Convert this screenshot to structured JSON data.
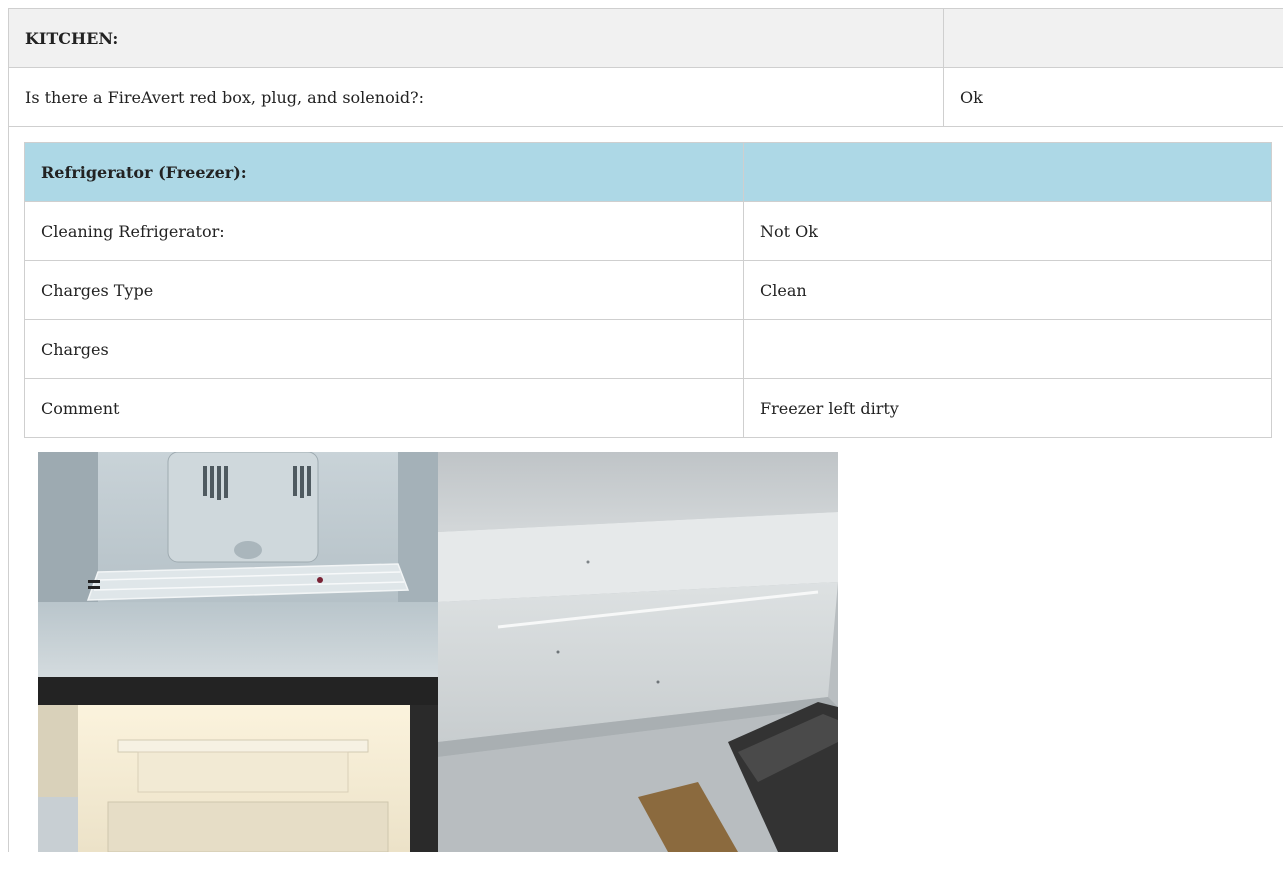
{
  "kitchen": {
    "header_label": "KITCHEN:",
    "header_value": "",
    "rows": [
      {
        "label": "Is there a FireAvert red box, plug, and solenoid?:",
        "value": "Ok"
      }
    ]
  },
  "refrigerator": {
    "header_label": "Refrigerator (Freezer):",
    "header_value": "",
    "rows": [
      {
        "label": "Cleaning Refrigerator:",
        "value": "Not Ok"
      },
      {
        "label": "Charges Type",
        "value": "Clean"
      },
      {
        "label": "Charges",
        "value": ""
      },
      {
        "label": "Comment",
        "value": "Freezer left dirty"
      }
    ]
  },
  "colors": {
    "section_header_bg": "#f1f1f1",
    "subsection_header_bg": "#add8e6",
    "border": "#cfcfcf"
  }
}
